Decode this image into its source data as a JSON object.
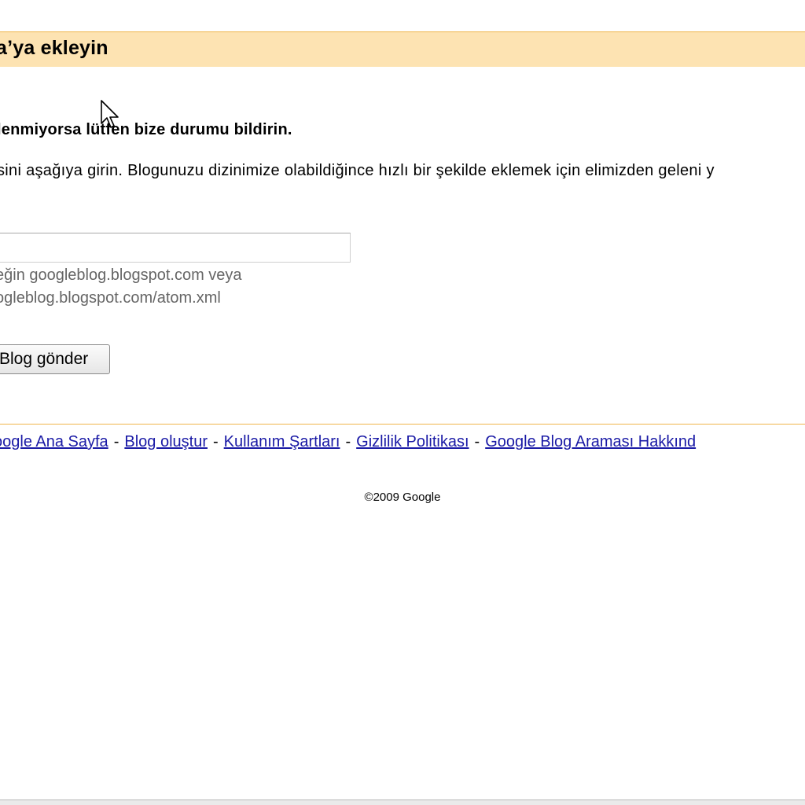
{
  "header": {
    "title": "a’ya ekleyin"
  },
  "main": {
    "subheading": "lenmiyorsa lütfen bize durumu bildirin.",
    "description": "sini aşağıya girin. Blogunuzu dizinimize olabildiğince hızlı bir şekilde eklemek için elimizden geleni y",
    "url_input": {
      "value": "",
      "placeholder": ""
    },
    "hint_line_1": "eğin googleblog.blogspot.com veya",
    "hint_line_2": "ogleblog.blogspot.com/atom.xml",
    "submit_label": "Blog gönder"
  },
  "footer": {
    "links": [
      "oogle Ana Sayfa",
      "Blog oluştur",
      "Kullanım Şartları",
      "Gizlilik Politikası",
      "Google Blog Araması Hakkınd"
    ],
    "separator": "-",
    "copyright": "©2009 Google"
  },
  "colors": {
    "header_background": "#fde3b2",
    "accent_border": "#f0b54b",
    "link": "#1a1aa6",
    "hint_text": "#666666"
  },
  "icons": {
    "cursor": "mouse-pointer-icon"
  }
}
